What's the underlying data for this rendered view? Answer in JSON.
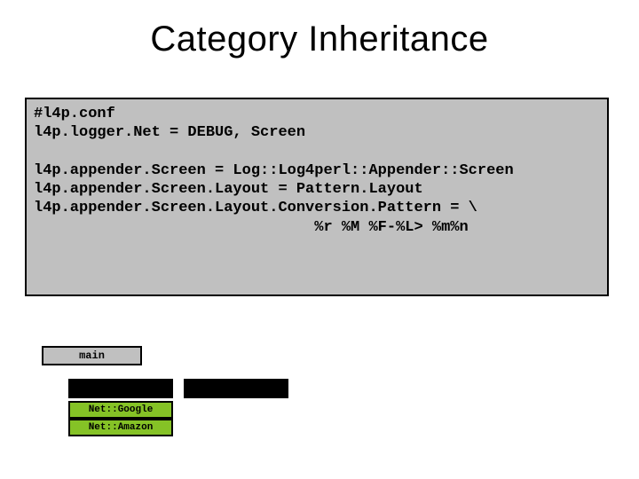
{
  "slide": {
    "title": "Category Inheritance"
  },
  "code": {
    "lines": "#l4p.conf\nl4p.logger.Net = DEBUG, Screen\n\nl4p.appender.Screen = Log::Log4perl::Appender::Screen\nl4p.appender.Screen.Layout = Pattern.Layout\nl4p.appender.Screen.Layout.Conversion.Pattern = \\\n                               %r %M %F-%L> %m%n"
  },
  "categories": {
    "main": "main",
    "google": "Net::Google",
    "amazon": "Net::Amazon"
  }
}
